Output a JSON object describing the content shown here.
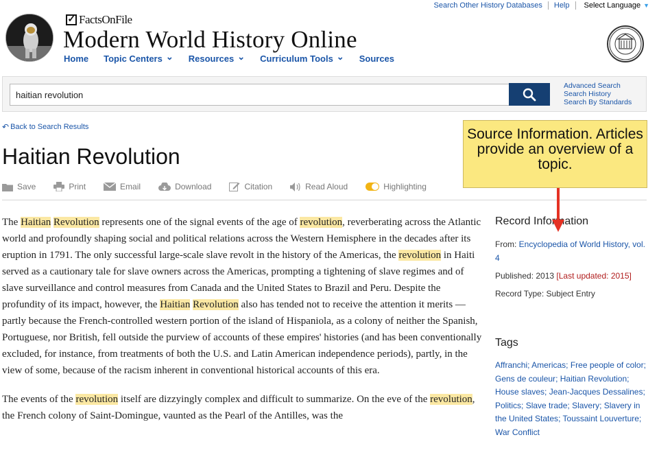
{
  "utility": {
    "search_other": "Search Other History Databases",
    "help": "Help",
    "language": "Select Language"
  },
  "header": {
    "publisher": "FactsOnFile",
    "site_title": "Modern World History Online",
    "nav": [
      {
        "label": "Home",
        "dropdown": false
      },
      {
        "label": "Topic Centers",
        "dropdown": true
      },
      {
        "label": "Resources",
        "dropdown": true
      },
      {
        "label": "Curriculum Tools",
        "dropdown": true
      },
      {
        "label": "Sources",
        "dropdown": false
      }
    ]
  },
  "search": {
    "value": "haitian revolution",
    "links": [
      "Advanced Search",
      "Search History",
      "Search By Standards"
    ]
  },
  "back_link": "Back to Search Results",
  "page_title": "Haitian Revolution",
  "toolbar": {
    "save": "Save",
    "print": "Print",
    "email": "Email",
    "download": "Download",
    "citation": "Citation",
    "read_aloud": "Read Aloud",
    "highlighting": "Highlighting"
  },
  "callout": "Source Information. Articles provide an overview of a topic.",
  "record": {
    "heading": "Record Information",
    "from_label": "From: ",
    "from_link": "Encyclopedia of World History, vol. 4",
    "published": "Published: 2013",
    "last_updated": "[Last updated: 2015]",
    "record_type": "Record Type: Subject Entry"
  },
  "tags": {
    "heading": "Tags",
    "items": [
      "Affranchi",
      "Americas",
      "Free people of color",
      "Gens de couleur",
      "Haitian Revolution",
      "House slaves",
      "Jean-Jacques Dessalines",
      "Politics",
      "Slave trade",
      "Slavery",
      "Slavery in the United States",
      "Toussaint Louverture",
      "War Conflict"
    ]
  },
  "article": {
    "p1": [
      {
        "t": "The "
      },
      {
        "t": "Haitian",
        "h": true
      },
      {
        "t": " "
      },
      {
        "t": "Revolution",
        "h": true
      },
      {
        "t": " represents one of the signal events of the age of "
      },
      {
        "t": "revolution",
        "h": true
      },
      {
        "t": ", reverberating across the Atlantic world and profoundly shaping social and political relations across the Western Hemisphere in the decades after its eruption in 1791. The only successful large-scale slave revolt in the history of the Americas, the "
      },
      {
        "t": "revolution",
        "h": true
      },
      {
        "t": " in Haiti served as a cautionary tale for slave owners across the Americas, prompting a tightening of slave regimes and of slave surveillance and control measures from Canada and the United States to Brazil and Peru. Despite the profundity of its impact, however, the "
      },
      {
        "t": "Haitian",
        "h": true
      },
      {
        "t": " "
      },
      {
        "t": "Revolution",
        "h": true
      },
      {
        "t": " also has tended not to receive the attention it merits —partly because the French-controlled western portion of the island of Hispaniola, as a colony of neither the Spanish, Portuguese, nor British, fell outside the purview of accounts of these empires' histories (and has been conventionally excluded, for instance, from treatments of both the U.S. and Latin American independence periods), partly, in the view of some, because of the racism inherent in conventional historical accounts of this era."
      }
    ],
    "p2": [
      {
        "t": "The events of the "
      },
      {
        "t": "revolution",
        "h": true
      },
      {
        "t": " itself are dizzyingly complex and difficult to summarize. On the eve of the "
      },
      {
        "t": "revolution",
        "h": true
      },
      {
        "t": ", the French colony of Saint-Domingue, vaunted as the Pearl of the Antilles, was the"
      }
    ]
  }
}
